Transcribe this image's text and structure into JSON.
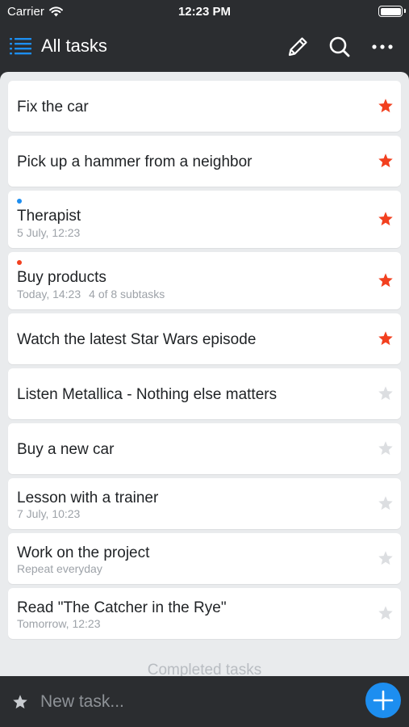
{
  "status_bar": {
    "carrier": "Carrier",
    "time": "12:23 PM"
  },
  "nav": {
    "title": "All tasks",
    "icons": {
      "menu": "list-icon",
      "edit": "pencil-icon",
      "search": "search-icon",
      "more": "more-icon"
    }
  },
  "colors": {
    "star_active": "#f2401f",
    "star_inactive": "#dcdee1",
    "dot_blue": "#1d8ef0",
    "dot_red": "#f2401f",
    "accent": "#1d8ef0"
  },
  "tasks": [
    {
      "title": "Fix the car",
      "subtitle": "",
      "starred": true
    },
    {
      "title": "Pick up a hammer from a neighbor",
      "subtitle": "",
      "starred": true
    },
    {
      "title": "Therapist",
      "subtitle": "5 July, 12:23",
      "starred": true,
      "dot": "blue"
    },
    {
      "title": "Buy products",
      "subtitle": "Today, 14:23",
      "subtitle2": "4 of 8 subtasks",
      "starred": true,
      "dot": "red"
    },
    {
      "title": "Watch the latest Star Wars episode",
      "subtitle": "",
      "starred": true
    },
    {
      "title": "Listen Metallica - Nothing else matters",
      "subtitle": "",
      "starred": false
    },
    {
      "title": "Buy a new car",
      "subtitle": "",
      "starred": false
    },
    {
      "title": "Lesson with a trainer",
      "subtitle": "7 July, 10:23",
      "starred": false
    },
    {
      "title": "Work on the project",
      "subtitle": "Repeat everyday",
      "starred": false
    },
    {
      "title": "Read \"The Catcher in the Rye\"",
      "subtitle": "Tomorrow, 12:23",
      "starred": false
    }
  ],
  "completed_label": "Completed tasks",
  "new_task": {
    "placeholder": "New task...",
    "value": ""
  }
}
